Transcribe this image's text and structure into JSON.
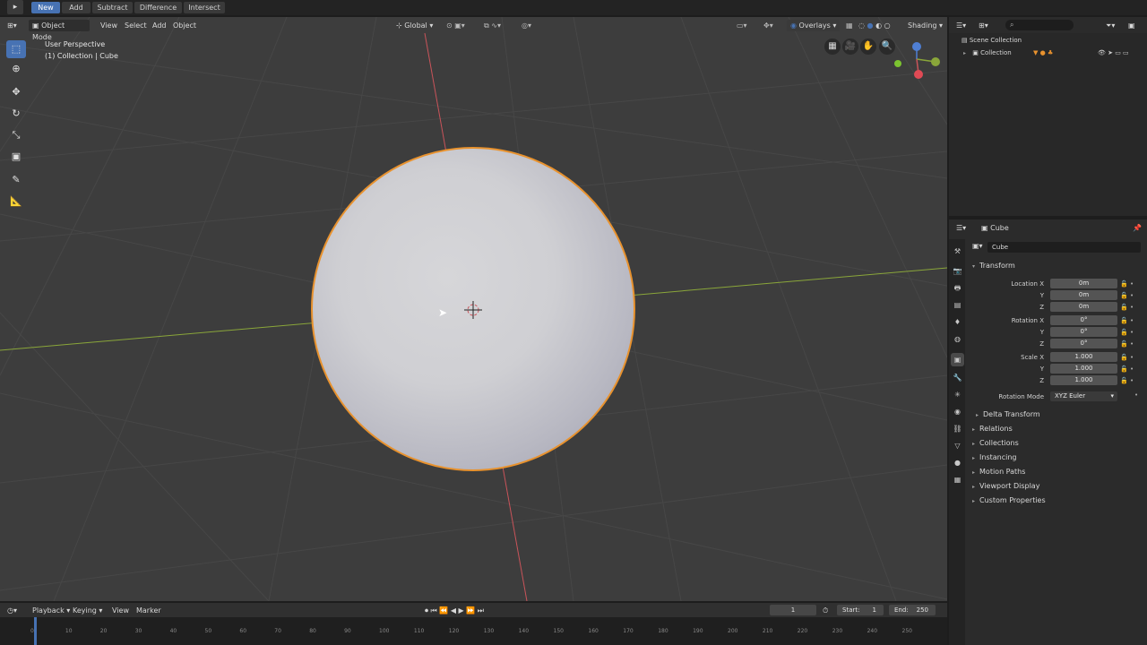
{
  "topbar": {
    "buttons": [
      "New",
      "Add",
      "Subtract",
      "Difference",
      "Intersect"
    ]
  },
  "viewport": {
    "mode": "Object Mode",
    "menus": [
      "View",
      "Select",
      "Add",
      "Object"
    ],
    "transform_orientation": "Global",
    "overlays_label": "Overlays",
    "shading_label": "Shading",
    "perspective_label": "User Perspective",
    "collection_label": "(1) Collection | Cube"
  },
  "outliner": {
    "scene_collection": "Scene Collection",
    "collection": "Collection"
  },
  "properties": {
    "object_name": "Cube",
    "object_name_field": "Cube",
    "transform_title": "Transform",
    "location_label": "Location X",
    "rotation_label": "Rotation X",
    "scale_label": "Scale X",
    "y_label": "Y",
    "z_label": "Z",
    "location": [
      "0m",
      "0m",
      "0m"
    ],
    "rotation": [
      "0°",
      "0°",
      "0°"
    ],
    "scale": [
      "1.000",
      "1.000",
      "1.000"
    ],
    "rotation_mode_label": "Rotation Mode",
    "rotation_mode_value": "XYZ Euler",
    "delta_transform": "Delta Transform",
    "panels": [
      "Relations",
      "Collections",
      "Instancing",
      "Motion Paths",
      "Viewport Display",
      "Custom Properties"
    ]
  },
  "timeline": {
    "menus": [
      "Playback",
      "Keying",
      "View",
      "Marker"
    ],
    "current_frame": "1",
    "start_label": "Start:",
    "start_value": "1",
    "end_label": "End:",
    "end_value": "250",
    "ticks": [
      "0",
      "10",
      "20",
      "30",
      "40",
      "50",
      "60",
      "70",
      "80",
      "90",
      "100",
      "110",
      "120",
      "130",
      "140",
      "150",
      "160",
      "170",
      "180",
      "190",
      "200",
      "210",
      "220",
      "230",
      "240",
      "250"
    ]
  },
  "colors": {
    "accent": "#4772b3",
    "selection_outline": "#e8922e",
    "x_axis": "#c9545a",
    "y_axis": "#8aa63a",
    "viewport_bg": "#3d3d3d"
  },
  "icons": {
    "tools": [
      "select-box-icon",
      "cursor-icon",
      "move-icon",
      "rotate-icon",
      "scale-icon",
      "transform-icon",
      "annotate-icon",
      "measure-icon"
    ]
  }
}
